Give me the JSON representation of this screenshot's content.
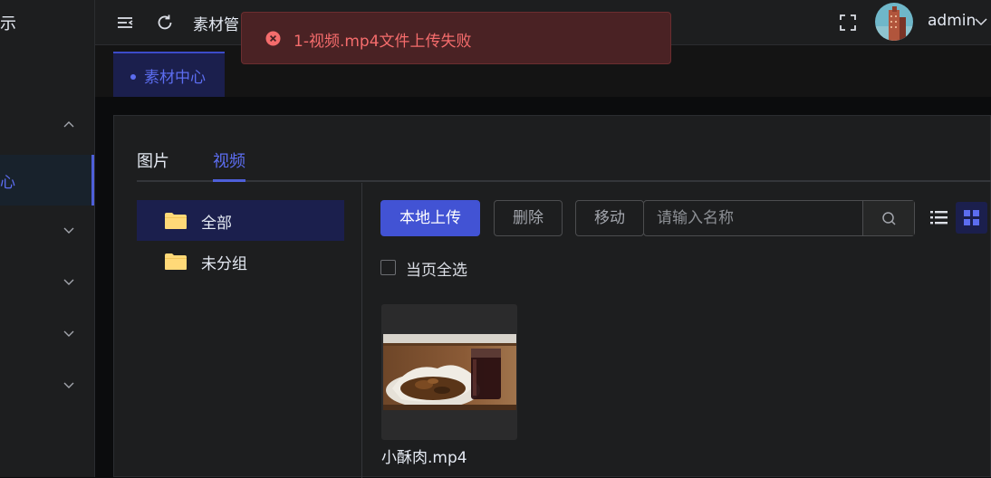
{
  "sidebar": {
    "logo_text": "示",
    "active_item_label": "心"
  },
  "header": {
    "title": "素材管",
    "username": "admin"
  },
  "tabbar": {
    "active_tab": "素材中心"
  },
  "toast": {
    "message": "1-视频.mp4文件上传失败"
  },
  "main": {
    "tabs": [
      {
        "label": "图片"
      },
      {
        "label": "视频"
      }
    ],
    "folders": [
      {
        "label": "全部"
      },
      {
        "label": "未分组"
      }
    ],
    "toolbar": {
      "upload_label": "本地上传",
      "delete_label": "删除",
      "move_label": "移动",
      "search_placeholder": "请输入名称"
    },
    "select_all_label": "当页全选",
    "media_items": [
      {
        "name": "小酥肉.mp4"
      }
    ]
  },
  "colors": {
    "accent": "#4e5fd9",
    "error": "#f56c6c",
    "background": "#1d1e1f"
  }
}
